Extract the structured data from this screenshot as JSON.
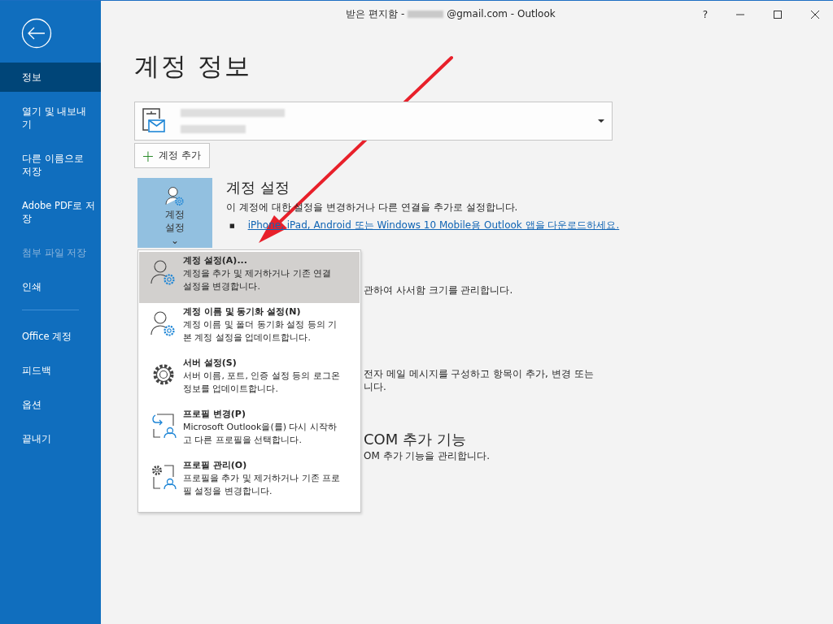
{
  "window": {
    "title_prefix": "받은 편지함 -",
    "title_suffix": "@gmail.com  -  Outlook",
    "controls": [
      "?"
    ]
  },
  "sidebar": {
    "items": [
      {
        "label": "정보",
        "selected": true,
        "disabled": false,
        "kind": "item"
      },
      {
        "label": "열기 및 내보내기",
        "selected": false,
        "disabled": false,
        "kind": "item"
      },
      {
        "label": "다른 이름으로 저장",
        "selected": false,
        "disabled": false,
        "kind": "item"
      },
      {
        "label": "Adobe PDF로 저장",
        "selected": false,
        "disabled": false,
        "kind": "item"
      },
      {
        "label": "첨부 파일 저장",
        "selected": false,
        "disabled": true,
        "kind": "item"
      },
      {
        "label": "인쇄",
        "selected": false,
        "disabled": false,
        "kind": "item"
      },
      {
        "kind": "separator"
      },
      {
        "label": "Office 계정",
        "selected": false,
        "disabled": false,
        "kind": "item"
      },
      {
        "label": "피드백",
        "selected": false,
        "disabled": false,
        "kind": "item"
      },
      {
        "label": "옵션",
        "selected": false,
        "disabled": false,
        "kind": "item"
      },
      {
        "label": "끝내기",
        "selected": false,
        "disabled": false,
        "kind": "item"
      }
    ]
  },
  "heading": "계정 정보",
  "add_account": {
    "icon": "+",
    "label": "계정 추가"
  },
  "account_settings": {
    "tile_label": "계정 설정",
    "caret": "⌄",
    "title": "계정 설정",
    "description": "이 계정에 대한 설정을 변경하거나 다른 연결을 추가로 설정합니다.",
    "bullet": "■",
    "link": "iPhone, iPad, Android 또는 Windows 10 Mobile용 Outlook 앱을 다운로드하세요."
  },
  "partly_hidden": [
    {
      "kind": "text",
      "lines": [
        "관하여 사서함 크기를 관리합니다."
      ]
    },
    {
      "kind": "text",
      "lines": [
        "전자 메일 메시지를 구성하고 항목이 추가, 변경 또는",
        "니다."
      ]
    },
    {
      "kind": "heading",
      "lines": [
        "COM 추가 기능"
      ]
    },
    {
      "kind": "text",
      "lines": [
        "OM 추가 기능을 관리합니다."
      ]
    }
  ],
  "menu": [
    {
      "title": "계정 설정(A)...",
      "description": "계정을 추가 및 제거하거나 기존 연결 설정을 변경합니다.",
      "kind": "person-gear",
      "selected": true
    },
    {
      "title": "계정 이름 및 동기화 설정(N)",
      "description": "계정 이름 및 폴더 동기화 설정 등의 기본 계정 설정을 업데이트합니다.",
      "kind": "person-gear",
      "selected": false
    },
    {
      "title": "서버 설정(S)",
      "description": "서버 이름, 포트, 인증 설정 등의 로그온 정보를 업데이트합니다.",
      "kind": "gear",
      "selected": false
    },
    {
      "title": "프로필 변경(P)",
      "description": "Microsoft Outlook을(를) 다시 시작하고 다른 프로필을 선택합니다.",
      "kind": "profile-switch",
      "selected": false
    },
    {
      "title": "프로필 관리(O)",
      "description": "프로필을 추가 및 제거하거나 기존 프로필 설정을 변경합니다.",
      "kind": "profile-gear",
      "selected": false
    }
  ]
}
